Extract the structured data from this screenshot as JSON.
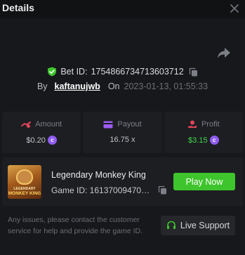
{
  "header": {
    "title": "Details"
  },
  "bet": {
    "id_label": "Bet ID:",
    "id_value": "1754866734713603712",
    "by_label": "By",
    "username": "kaftanujwb",
    "on_label": "On",
    "datetime": "2023-01-13, 01:55:33"
  },
  "stats": {
    "amount": {
      "label": "Amount",
      "value": "$0.20"
    },
    "payout": {
      "label": "Payout",
      "value": "16.75 x"
    },
    "profit": {
      "label": "Profit",
      "value": "$3.15"
    }
  },
  "coin_symbol": "c",
  "game": {
    "name": "Legendary Monkey King",
    "id_text": "Game ID: 1613700947061...",
    "thumb_line1": "LEGENDARY",
    "thumb_line2": "MONKEY KING",
    "play_label": "Play Now"
  },
  "footer": {
    "help_text": "Any issues, please contact the customer service for help and provide the game ID.",
    "support_label": "Live Support"
  },
  "colors": {
    "accent_green": "#3ec42c",
    "profit_green": "#3fd94a",
    "coin_purple": "#8f5cf0",
    "amount_icon": "#e0455a",
    "payout_icon": "#9b5cf2",
    "profit_icon": "#e0455a"
  }
}
